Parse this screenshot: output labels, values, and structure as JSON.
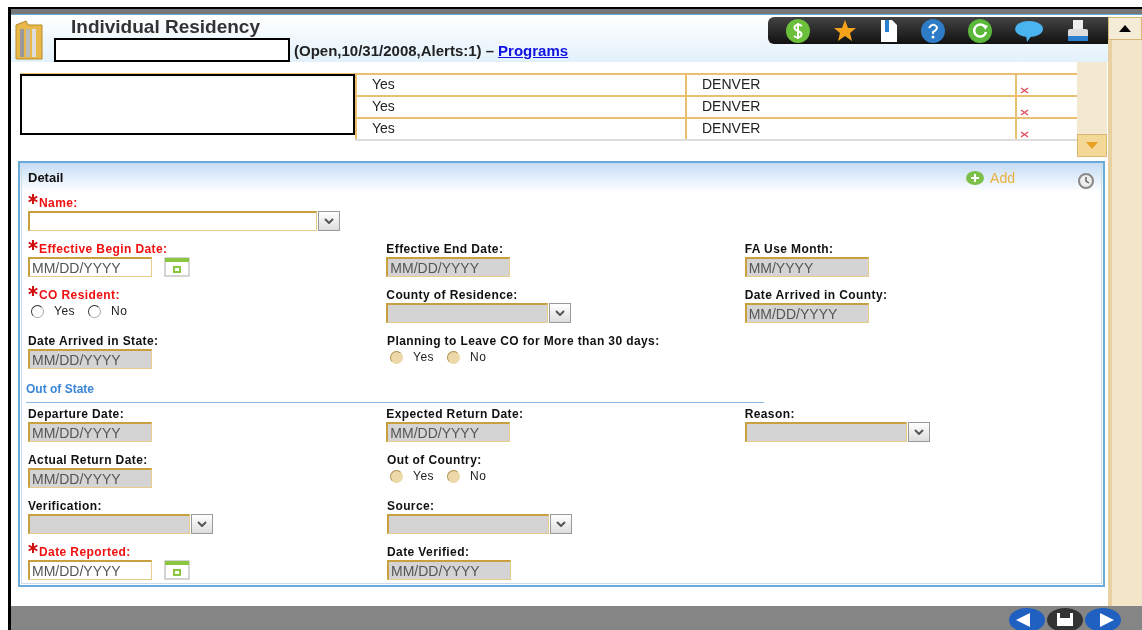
{
  "window": {
    "title": "Individual Residency"
  },
  "case_status": {
    "text": "(Open,10/31/2008,Alerts:1) –",
    "link": "Programs"
  },
  "table": {
    "rows": [
      {
        "column_2": "Yes",
        "column_3": "DENVER"
      },
      {
        "column_2": "Yes",
        "column_3": "DENVER"
      },
      {
        "column_2": "Yes",
        "column_3": "DENVER"
      }
    ]
  },
  "detail": {
    "title": "Detail",
    "add": "Add",
    "sections": [
      {
        "rows": [
          [
            {
              "label": "Name:",
              "required": true,
              "kind": "select",
              "disabled": false,
              "wide": true
            }
          ],
          [
            {
              "label": "Effective Begin Date:",
              "required": true,
              "kind": "date",
              "placeholder": "MM/DD/YYYY",
              "disabled": false,
              "calendar": true
            },
            {
              "label": "Effective End Date:",
              "required": false,
              "kind": "date",
              "placeholder": "MM/DD/YYYY",
              "disabled": true,
              "calendar": false
            },
            {
              "label": "FA Use Month:",
              "required": false,
              "kind": "date",
              "placeholder": "MM/YYYY",
              "disabled": true,
              "calendar": false
            }
          ],
          [
            {
              "label": "CO Resident:",
              "required": true,
              "kind": "radio",
              "disabled": false,
              "options": [
                {
                  "label": "Yes",
                  "selected": false
                },
                {
                  "label": "No",
                  "selected": false
                }
              ]
            },
            {
              "label": "County of Residence:",
              "required": false,
              "kind": "select",
              "disabled": true,
              "wide": false
            },
            {
              "label": "Date Arrived in County:",
              "required": false,
              "kind": "date",
              "placeholder": "MM/DD/YYYY",
              "disabled": true,
              "calendar": false
            }
          ],
          [
            {
              "label": "Date Arrived in State:",
              "required": false,
              "kind": "date",
              "placeholder": "MM/DD/YYYY",
              "disabled": true,
              "calendar": false
            },
            {
              "label": "Planning to Leave CO for More than 30 days:",
              "required": false,
              "kind": "radio",
              "disabled": true,
              "options": [
                {
                  "label": "Yes",
                  "selected": false
                },
                {
                  "label": "No",
                  "selected": false
                }
              ]
            }
          ]
        ]
      },
      {
        "title": "Out of State",
        "rows": [
          [
            {
              "label": "Departure Date:",
              "required": false,
              "kind": "date",
              "placeholder": "MM/DD/YYYY",
              "disabled": true,
              "calendar": false
            },
            {
              "label": "Expected Return Date:",
              "required": false,
              "kind": "date",
              "placeholder": "MM/DD/YYYY",
              "disabled": true,
              "calendar": false
            },
            {
              "label": "Reason:",
              "required": false,
              "kind": "select",
              "disabled": true,
              "wide": false
            }
          ],
          [
            {
              "label": "Actual Return Date:",
              "required": false,
              "kind": "date",
              "placeholder": "MM/DD/YYYY",
              "disabled": true,
              "calendar": false
            },
            {
              "label": "Out of Country:",
              "required": false,
              "kind": "radio",
              "disabled": true,
              "options": [
                {
                  "label": "Yes",
                  "selected": false
                },
                {
                  "label": "No",
                  "selected": false
                }
              ]
            }
          ],
          [
            {
              "label": "Verification:",
              "required": false,
              "kind": "select",
              "disabled": true,
              "wide": false
            },
            {
              "label": "Source:",
              "required": false,
              "kind": "select",
              "disabled": true,
              "wide": false
            }
          ],
          [
            {
              "label": "Date Reported:",
              "required": true,
              "kind": "date",
              "placeholder": "MM/DD/YYYY",
              "disabled": false,
              "calendar": true
            },
            {
              "label": "Date Verified:",
              "required": false,
              "kind": "date",
              "placeholder": "MM/DD/YYYY",
              "disabled": true,
              "calendar": false
            }
          ]
        ]
      }
    ]
  }
}
